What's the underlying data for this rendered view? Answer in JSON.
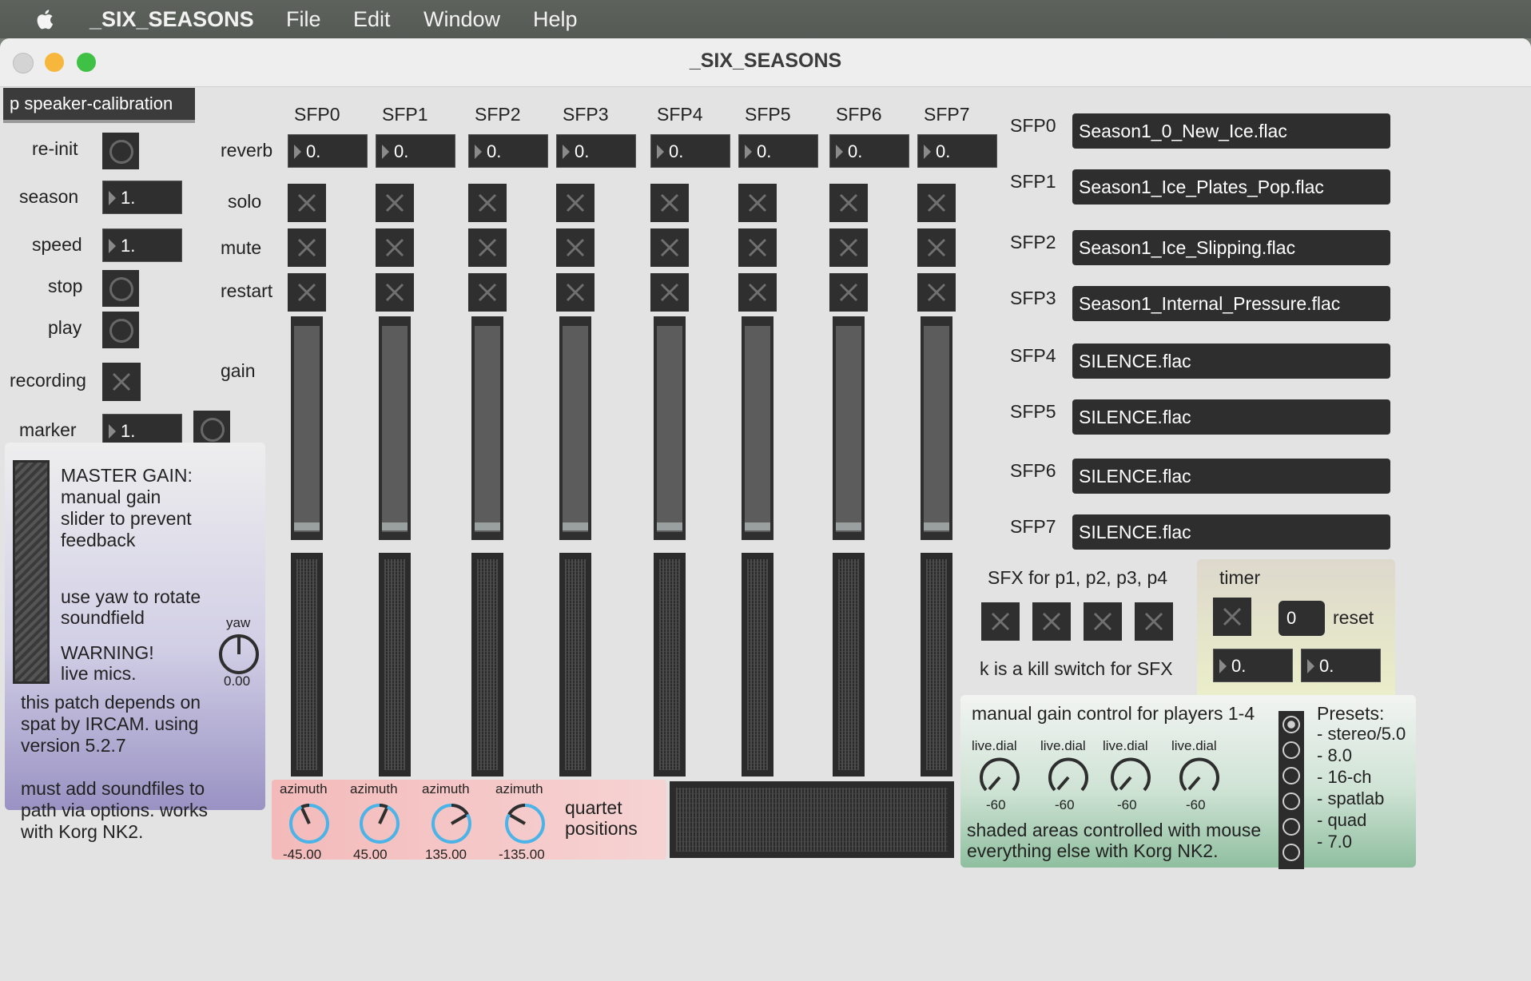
{
  "menubar": {
    "app_name": "_SIX_SEASONS",
    "items": [
      "File",
      "Edit",
      "Window",
      "Help"
    ]
  },
  "window": {
    "title": "_SIX_SEASONS"
  },
  "left": {
    "subpatch": "p speaker-calibration",
    "reinit": "re-init",
    "season_label": "season",
    "season_value": "1.",
    "speed_label": "speed",
    "speed_value": "1.",
    "stop": "stop",
    "play": "play",
    "recording": "recording",
    "marker_label": "marker",
    "marker_value": "1."
  },
  "master": {
    "text1": "MASTER GAIN: manual gain slider to prevent feedback",
    "text2": "use yaw to rotate soundfield",
    "text3": "WARNING! live mics.",
    "text4": "this patch depends on spat by IRCAM. using version 5.2.7",
    "text5": "must add soundfiles to path via options. works with Korg NK2.",
    "yaw_label": "yaw",
    "yaw_value": "0.00"
  },
  "mixer": {
    "channels": [
      "SFP0",
      "SFP1",
      "SFP2",
      "SFP3",
      "SFP4",
      "SFP5",
      "SFP6",
      "SFP7"
    ],
    "reverb_label": "reverb",
    "reverb_values": [
      "0.",
      "0.",
      "0.",
      "0.",
      "0.",
      "0.",
      "0.",
      "0."
    ],
    "solo_label": "solo",
    "mute_label": "mute",
    "restart_label": "restart",
    "gain_label": "gain"
  },
  "azimuth": {
    "label": "azimuth",
    "values": [
      "-45.00",
      "45.00",
      "135.00",
      "-135.00"
    ],
    "quartet_text": "quartet positions"
  },
  "files": {
    "labels": [
      "SFP0",
      "SFP1",
      "SFP2",
      "SFP3",
      "SFP4",
      "SFP5",
      "SFP6",
      "SFP7"
    ],
    "names": [
      "Season1_0_New_Ice.flac",
      "Season1_Ice_Plates_Pop.flac",
      "Season1_Ice_Slipping.flac",
      "Season1_Internal_Pressure.flac",
      "SILENCE.flac",
      "SILENCE.flac",
      "SILENCE.flac",
      "SILENCE.flac"
    ]
  },
  "sfx": {
    "title": "SFX for p1, p2, p3, p4",
    "kill_text": "k is a kill switch for SFX"
  },
  "timer": {
    "title": "timer",
    "count": "0",
    "reset": "reset",
    "value1": "0.",
    "value2": "0."
  },
  "manual_gain": {
    "title": "manual gain control for players 1-4",
    "dial_label": "live.dial",
    "dial_values": [
      "-60",
      "-60",
      "-60",
      "-60"
    ],
    "footer": "shaded areas controlled with mouse everything else with Korg NK2."
  },
  "presets": {
    "title": "Presets:",
    "items": [
      "- stereo/5.0",
      "- 8.0",
      "- 16-ch",
      "- spatlab",
      "- quad",
      "- 7.0"
    ]
  },
  "colors": {
    "accent_dial": "#4ab3e8",
    "master_panel": "#b9b3d6",
    "azimuth_panel": "#f4c4c4",
    "gain_panel": "#a9cdb5",
    "timer_panel": "#e2e4cf"
  }
}
